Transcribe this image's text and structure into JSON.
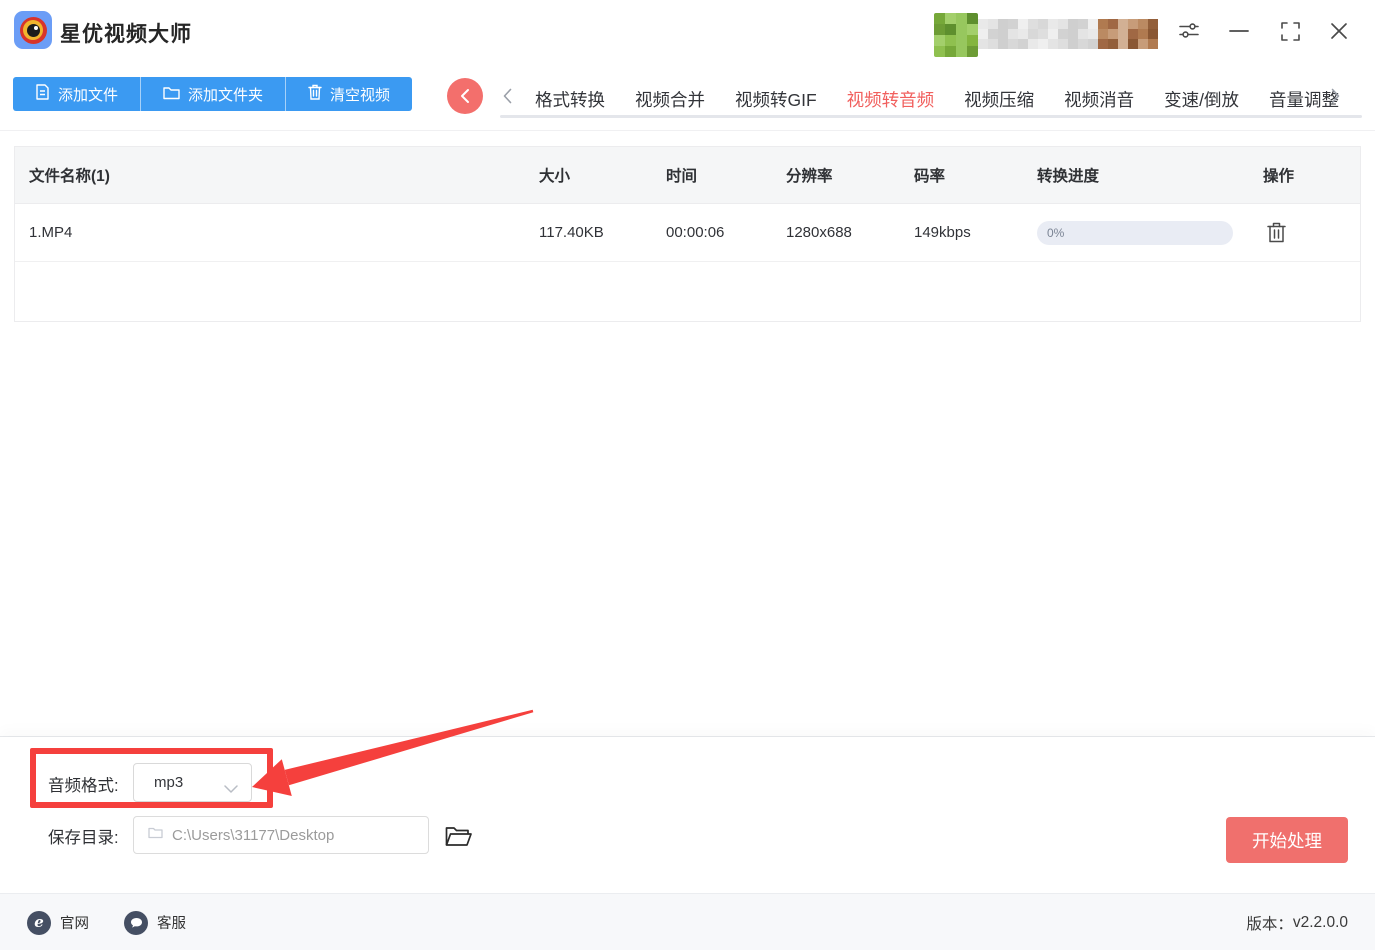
{
  "window": {
    "title": "星优视频大师"
  },
  "toolbar": {
    "buttons": [
      {
        "label": "添加文件"
      },
      {
        "label": "添加文件夹"
      },
      {
        "label": "清空视频"
      }
    ]
  },
  "tabs": {
    "items": [
      "格式转换",
      "视频合并",
      "视频转GIF",
      "视频转音频",
      "视频压缩",
      "视频消音",
      "变速/倒放",
      "音量调整"
    ],
    "active": "视频转音频"
  },
  "table": {
    "headers": [
      "文件名称(1)",
      "大小",
      "时间",
      "分辨率",
      "码率",
      "转换进度",
      "操作"
    ],
    "rows": [
      {
        "name": "1.MP4",
        "size": "117.40KB",
        "duration": "00:00:06",
        "resolution": "1280x688",
        "bitrate": "149kbps",
        "progress": "0%"
      }
    ]
  },
  "settings_panel": {
    "audio_format_label": "音频格式:",
    "audio_format_value": "mp3",
    "save_dir_label": "保存目录:",
    "save_dir_value": "C:\\Users\\31177\\Desktop",
    "start_button": "开始处理"
  },
  "footer": {
    "website": "官网",
    "website_icon_letter": "e",
    "support": "客服",
    "version_label": "版本：",
    "version_value": "v2.2.0.0"
  },
  "colors": {
    "toolbar_blue": "#3b9af2",
    "active_tab_red": "#f15f5d",
    "back_circle_red": "#f36f6c",
    "start_button_red": "#f0706d",
    "annotation_red": "#f5403d",
    "progress_pill_bg": "#e9ecf4",
    "footer_icon_navy": "#454f63"
  },
  "user_mosaic": {
    "avatar": {
      "cols": 4,
      "rows": 4,
      "size": 11,
      "palette": [
        "#76a839",
        "#8fc04f",
        "#5e8f2e",
        "#a3cf6b",
        "#84b53f",
        "#6d9c35",
        "#97c75e"
      ]
    },
    "strip": {
      "cols": 12,
      "rows": 3,
      "size": 10,
      "palette": [
        "#e9e9e9",
        "#dedede",
        "#d2d2d2",
        "#e4e4e4",
        "#d8d8d8",
        "#efefef",
        "#cfcfcf"
      ]
    },
    "brown": {
      "cols": 6,
      "rows": 3,
      "size": 10,
      "palette": [
        "#b07a50",
        "#935f3a",
        "#c79c79",
        "#a06844",
        "#8a5733",
        "#bb8a62",
        "#d2b094"
      ]
    }
  }
}
